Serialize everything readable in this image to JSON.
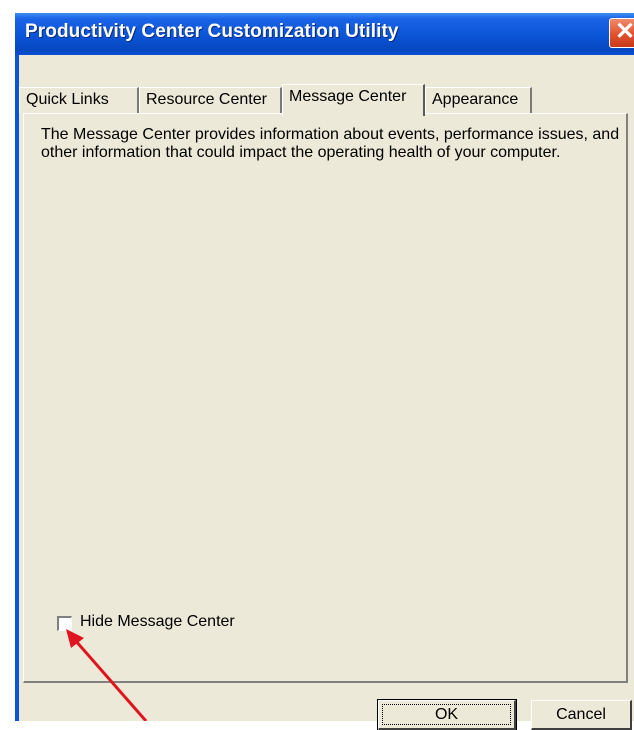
{
  "window": {
    "title": "Productivity Center Customization Utility",
    "close_glyph": "✕"
  },
  "tabs": [
    {
      "label": "Quick Links",
      "active": false
    },
    {
      "label": "Resource Center",
      "active": false
    },
    {
      "label": "Message Center",
      "active": true
    },
    {
      "label": "Appearance",
      "active": false
    }
  ],
  "message_center": {
    "description": "The Message Center provides information about events, performance issues, and other information that could impact the operating health of your computer.",
    "hide_checkbox_label": "Hide Message Center",
    "hide_checked": false
  },
  "buttons": {
    "ok_label": "OK",
    "cancel_label": "Cancel"
  },
  "annotation": {
    "arrow_color": "#e0141e"
  },
  "colors": {
    "titlebar": "#0a54d6",
    "dialog_face": "#ece9d8",
    "close_button": "#e0532e"
  }
}
